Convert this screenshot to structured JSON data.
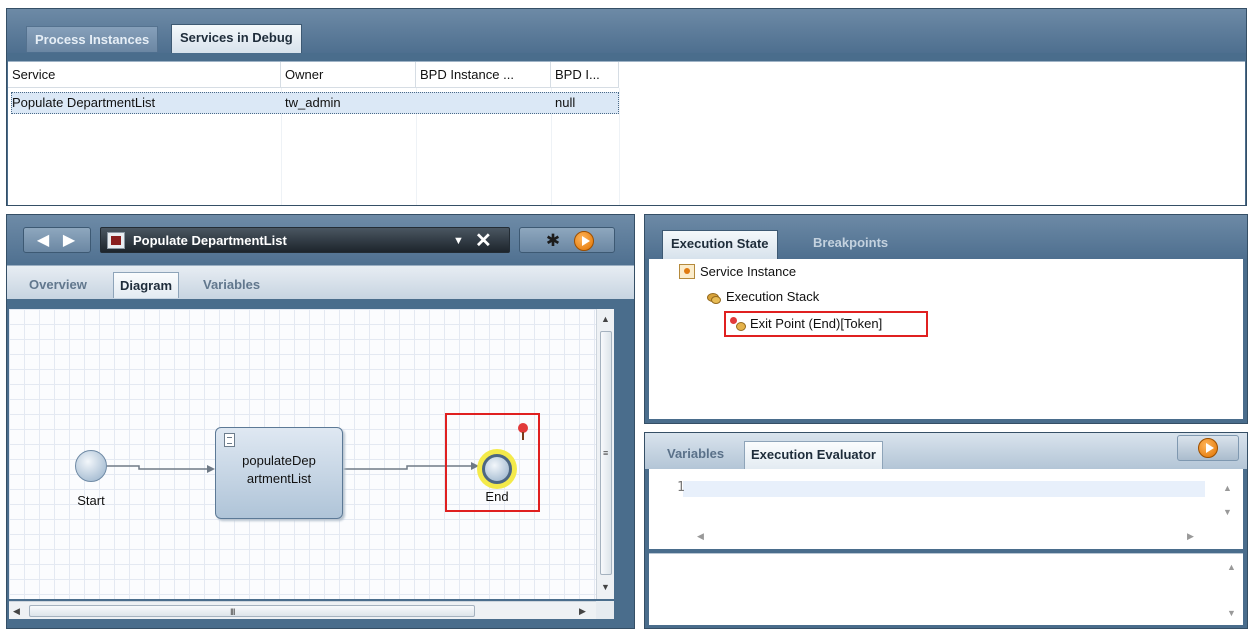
{
  "services_panel": {
    "tabs": [
      {
        "label": "Process Instances",
        "active": false
      },
      {
        "label": "Services in Debug",
        "active": true
      }
    ],
    "columns": [
      "Service",
      "Owner",
      "BPD Instance ...",
      "BPD I..."
    ],
    "rows": [
      {
        "service": "Populate DepartmentList",
        "owner": "tw_admin",
        "bpd_instance": "",
        "bpd_id": "null",
        "selected": true
      }
    ]
  },
  "diagram_panel": {
    "service_name": "Populate DepartmentList",
    "subtabs": [
      {
        "label": "Overview",
        "active": false
      },
      {
        "label": "Diagram",
        "active": true
      },
      {
        "label": "Variables",
        "active": false
      }
    ],
    "diagram": {
      "start_label": "Start",
      "task_label": "populateDep artmentList",
      "end_label": "End"
    },
    "scroll_grip": "III",
    "vscroll_grip": "≡"
  },
  "execution_panel": {
    "tabs": [
      {
        "label": "Execution State",
        "active": true
      },
      {
        "label": "Breakpoints",
        "active": false
      }
    ],
    "tree": [
      {
        "label": "Service Instance",
        "icon": "service-instance-icon",
        "depth": 0
      },
      {
        "label": "Execution Stack",
        "icon": "execution-stack-icon",
        "depth": 1
      },
      {
        "label": "Exit Point (End)[Token]",
        "icon": "token-icon",
        "depth": 2,
        "highlighted": true
      }
    ]
  },
  "evaluator_panel": {
    "tabs": [
      {
        "label": "Variables",
        "active": false
      },
      {
        "label": "Execution Evaluator",
        "active": true
      }
    ],
    "line_number": "1"
  },
  "colors": {
    "panel_frame": "#4a6d8c",
    "selection": "#dbe8f6",
    "highlight_border": "#e02020",
    "run_button": "#e07200",
    "end_glow": "#f4ea4a"
  }
}
